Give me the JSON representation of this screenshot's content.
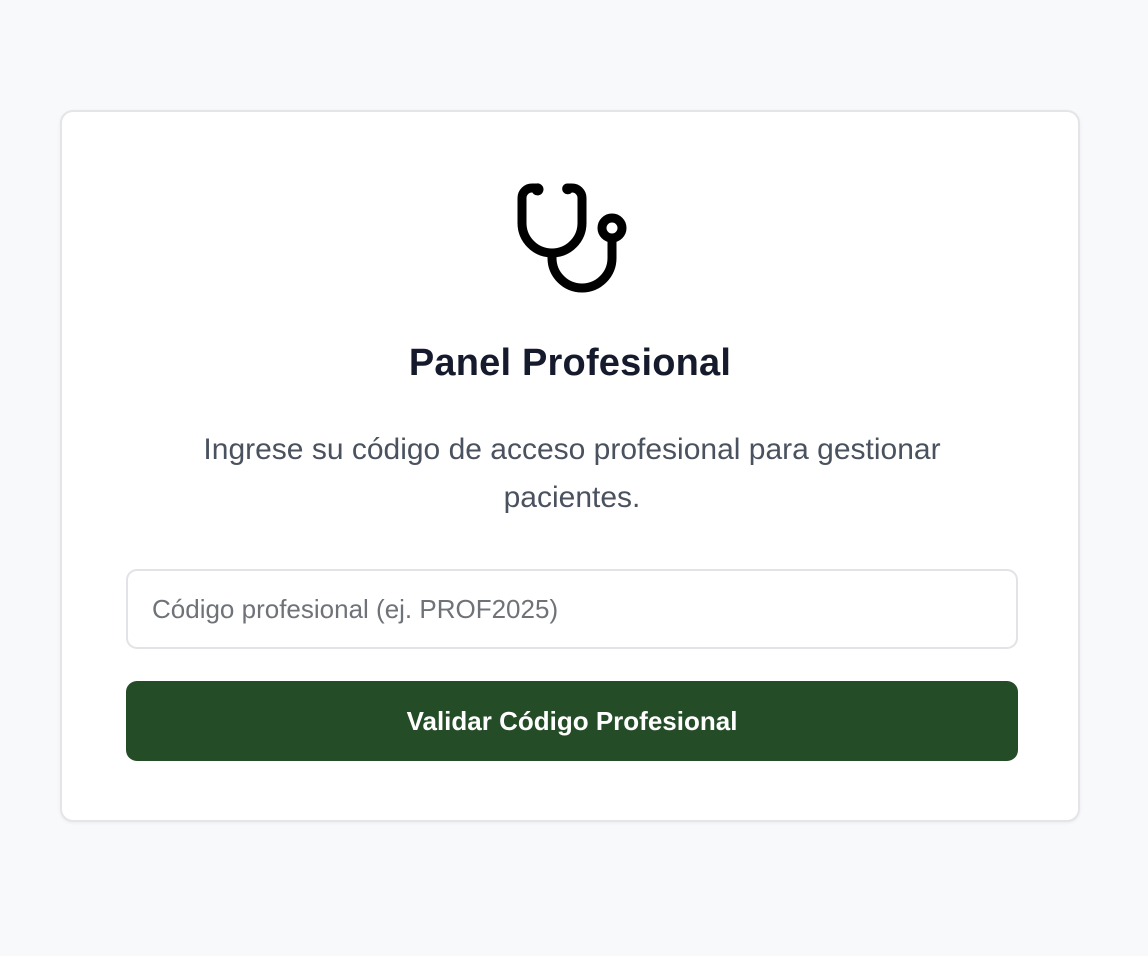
{
  "card": {
    "icon": "stethoscope-icon",
    "title": "Panel Profesional",
    "subtitle": "Ingrese su código de acceso profesional para gestionar pacientes.",
    "code_input": {
      "value": "",
      "placeholder": "Código profesional (ej. PROF2025)"
    },
    "submit_label": "Validar Código Profesional"
  },
  "colors": {
    "page_background": "#f8f9fb",
    "card_background": "#ffffff",
    "title_text": "#151a2d",
    "subtitle_text": "#4a5260",
    "button_background": "#244c27",
    "button_text": "#ffffff"
  }
}
